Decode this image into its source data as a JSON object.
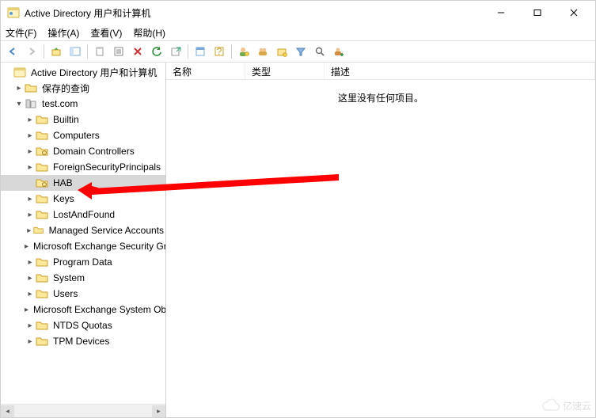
{
  "titlebar": {
    "title": "Active Directory 用户和计算机"
  },
  "menubar": {
    "file": "文件(F)",
    "action": "操作(A)",
    "view": "查看(V)",
    "help": "帮助(H)"
  },
  "tree": {
    "root": "Active Directory 用户和计算机",
    "saved_queries": "保存的查询",
    "domain": "test.com",
    "nodes": {
      "builtin": "Builtin",
      "computers": "Computers",
      "dc": "Domain Controllers",
      "fsp": "ForeignSecurityPrincipals",
      "hab": "HAB",
      "keys": "Keys",
      "laf": "LostAndFound",
      "msa": "Managed Service Accounts",
      "mes": "Microsoft Exchange Security Groups",
      "pd": "Program Data",
      "sys": "System",
      "users": "Users",
      "mesys": "Microsoft Exchange System Objects",
      "ntds": "NTDS Quotas",
      "tpm": "TPM Devices"
    }
  },
  "list": {
    "col_name": "名称",
    "col_type": "类型",
    "col_desc": "描述",
    "empty": "这里没有任何项目。"
  },
  "watermark": "亿速云"
}
